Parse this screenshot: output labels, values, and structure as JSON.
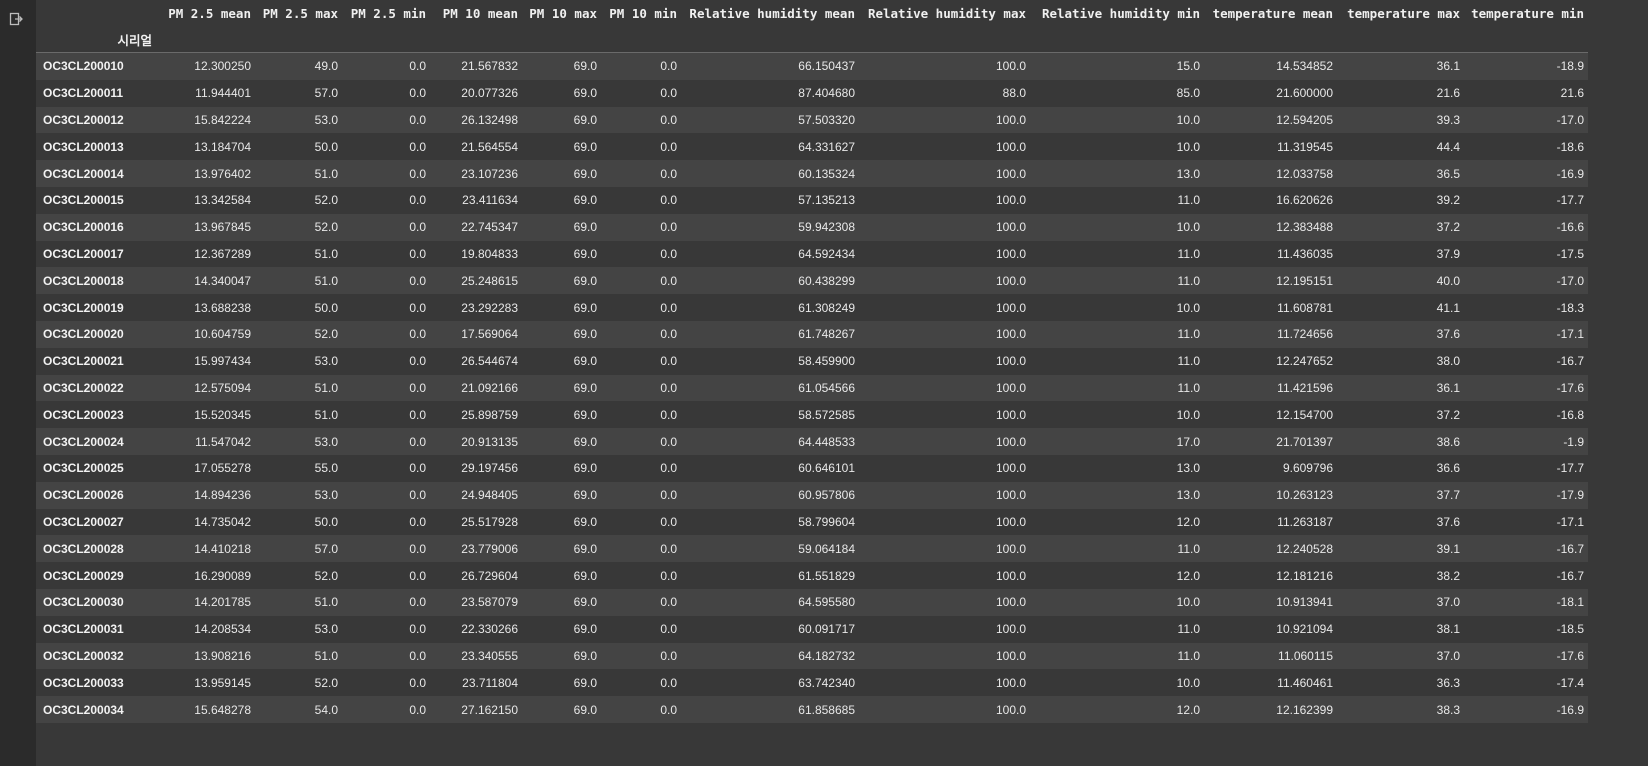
{
  "columns": [
    "PM 2.5 mean",
    "PM 2.5 max",
    "PM 2.5 min",
    "PM 10 mean",
    "PM 10 max",
    "PM 10 min",
    "Relative humidity mean",
    "Relative humidity max",
    "Relative humidity min",
    "temperature mean",
    "temperature max",
    "temperature min"
  ],
  "index_name": "시리얼",
  "rows": [
    {
      "id": "OC3CL200010",
      "values": [
        "12.300250",
        "49.0",
        "0.0",
        "21.567832",
        "69.0",
        "0.0",
        "66.150437",
        "100.0",
        "15.0",
        "14.534852",
        "36.1",
        "-18.9"
      ]
    },
    {
      "id": "OC3CL200011",
      "values": [
        "11.944401",
        "57.0",
        "0.0",
        "20.077326",
        "69.0",
        "0.0",
        "87.404680",
        "88.0",
        "85.0",
        "21.600000",
        "21.6",
        "21.6"
      ]
    },
    {
      "id": "OC3CL200012",
      "values": [
        "15.842224",
        "53.0",
        "0.0",
        "26.132498",
        "69.0",
        "0.0",
        "57.503320",
        "100.0",
        "10.0",
        "12.594205",
        "39.3",
        "-17.0"
      ]
    },
    {
      "id": "OC3CL200013",
      "values": [
        "13.184704",
        "50.0",
        "0.0",
        "21.564554",
        "69.0",
        "0.0",
        "64.331627",
        "100.0",
        "10.0",
        "11.319545",
        "44.4",
        "-18.6"
      ]
    },
    {
      "id": "OC3CL200014",
      "values": [
        "13.976402",
        "51.0",
        "0.0",
        "23.107236",
        "69.0",
        "0.0",
        "60.135324",
        "100.0",
        "13.0",
        "12.033758",
        "36.5",
        "-16.9"
      ]
    },
    {
      "id": "OC3CL200015",
      "values": [
        "13.342584",
        "52.0",
        "0.0",
        "23.411634",
        "69.0",
        "0.0",
        "57.135213",
        "100.0",
        "11.0",
        "16.620626",
        "39.2",
        "-17.7"
      ]
    },
    {
      "id": "OC3CL200016",
      "values": [
        "13.967845",
        "52.0",
        "0.0",
        "22.745347",
        "69.0",
        "0.0",
        "59.942308",
        "100.0",
        "10.0",
        "12.383488",
        "37.2",
        "-16.6"
      ]
    },
    {
      "id": "OC3CL200017",
      "values": [
        "12.367289",
        "51.0",
        "0.0",
        "19.804833",
        "69.0",
        "0.0",
        "64.592434",
        "100.0",
        "11.0",
        "11.436035",
        "37.9",
        "-17.5"
      ]
    },
    {
      "id": "OC3CL200018",
      "values": [
        "14.340047",
        "51.0",
        "0.0",
        "25.248615",
        "69.0",
        "0.0",
        "60.438299",
        "100.0",
        "11.0",
        "12.195151",
        "40.0",
        "-17.0"
      ]
    },
    {
      "id": "OC3CL200019",
      "values": [
        "13.688238",
        "50.0",
        "0.0",
        "23.292283",
        "69.0",
        "0.0",
        "61.308249",
        "100.0",
        "10.0",
        "11.608781",
        "41.1",
        "-18.3"
      ]
    },
    {
      "id": "OC3CL200020",
      "values": [
        "10.604759",
        "52.0",
        "0.0",
        "17.569064",
        "69.0",
        "0.0",
        "61.748267",
        "100.0",
        "11.0",
        "11.724656",
        "37.6",
        "-17.1"
      ]
    },
    {
      "id": "OC3CL200021",
      "values": [
        "15.997434",
        "53.0",
        "0.0",
        "26.544674",
        "69.0",
        "0.0",
        "58.459900",
        "100.0",
        "11.0",
        "12.247652",
        "38.0",
        "-16.7"
      ]
    },
    {
      "id": "OC3CL200022",
      "values": [
        "12.575094",
        "51.0",
        "0.0",
        "21.092166",
        "69.0",
        "0.0",
        "61.054566",
        "100.0",
        "11.0",
        "11.421596",
        "36.1",
        "-17.6"
      ]
    },
    {
      "id": "OC3CL200023",
      "values": [
        "15.520345",
        "51.0",
        "0.0",
        "25.898759",
        "69.0",
        "0.0",
        "58.572585",
        "100.0",
        "10.0",
        "12.154700",
        "37.2",
        "-16.8"
      ]
    },
    {
      "id": "OC3CL200024",
      "values": [
        "11.547042",
        "53.0",
        "0.0",
        "20.913135",
        "69.0",
        "0.0",
        "64.448533",
        "100.0",
        "17.0",
        "21.701397",
        "38.6",
        "-1.9"
      ]
    },
    {
      "id": "OC3CL200025",
      "values": [
        "17.055278",
        "55.0",
        "0.0",
        "29.197456",
        "69.0",
        "0.0",
        "60.646101",
        "100.0",
        "13.0",
        "9.609796",
        "36.6",
        "-17.7"
      ]
    },
    {
      "id": "OC3CL200026",
      "values": [
        "14.894236",
        "53.0",
        "0.0",
        "24.948405",
        "69.0",
        "0.0",
        "60.957806",
        "100.0",
        "13.0",
        "10.263123",
        "37.7",
        "-17.9"
      ]
    },
    {
      "id": "OC3CL200027",
      "values": [
        "14.735042",
        "50.0",
        "0.0",
        "25.517928",
        "69.0",
        "0.0",
        "58.799604",
        "100.0",
        "12.0",
        "11.263187",
        "37.6",
        "-17.1"
      ]
    },
    {
      "id": "OC3CL200028",
      "values": [
        "14.410218",
        "57.0",
        "0.0",
        "23.779006",
        "69.0",
        "0.0",
        "59.064184",
        "100.0",
        "11.0",
        "12.240528",
        "39.1",
        "-16.7"
      ]
    },
    {
      "id": "OC3CL200029",
      "values": [
        "16.290089",
        "52.0",
        "0.0",
        "26.729604",
        "69.0",
        "0.0",
        "61.551829",
        "100.0",
        "12.0",
        "12.181216",
        "38.2",
        "-16.7"
      ]
    },
    {
      "id": "OC3CL200030",
      "values": [
        "14.201785",
        "51.0",
        "0.0",
        "23.587079",
        "69.0",
        "0.0",
        "64.595580",
        "100.0",
        "10.0",
        "10.913941",
        "37.0",
        "-18.1"
      ]
    },
    {
      "id": "OC3CL200031",
      "values": [
        "14.208534",
        "53.0",
        "0.0",
        "22.330266",
        "69.0",
        "0.0",
        "60.091717",
        "100.0",
        "11.0",
        "10.921094",
        "38.1",
        "-18.5"
      ]
    },
    {
      "id": "OC3CL200032",
      "values": [
        "13.908216",
        "51.0",
        "0.0",
        "23.340555",
        "69.0",
        "0.0",
        "64.182732",
        "100.0",
        "11.0",
        "11.060115",
        "37.0",
        "-17.6"
      ]
    },
    {
      "id": "OC3CL200033",
      "values": [
        "13.959145",
        "52.0",
        "0.0",
        "23.711804",
        "69.0",
        "0.0",
        "63.742340",
        "100.0",
        "10.0",
        "11.460461",
        "36.3",
        "-17.4"
      ]
    },
    {
      "id": "OC3CL200034",
      "values": [
        "15.648278",
        "54.0",
        "0.0",
        "27.162150",
        "69.0",
        "0.0",
        "61.858685",
        "100.0",
        "12.0",
        "12.162399",
        "38.3",
        "-16.9"
      ]
    }
  ],
  "output_icon": "output-cell-icon",
  "colors": {
    "background": "#383838",
    "stripe": "#444444",
    "gutter": "#2b2b2b"
  }
}
